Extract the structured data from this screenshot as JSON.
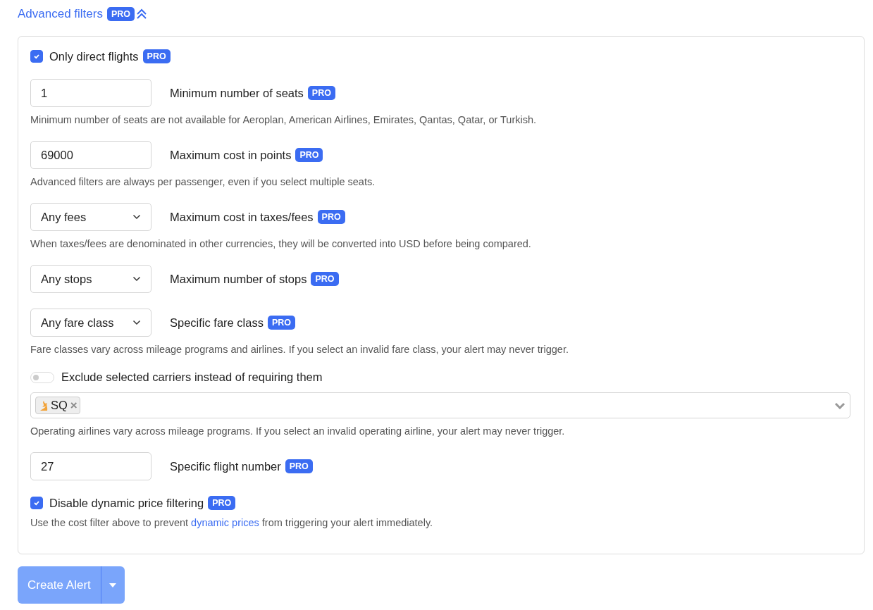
{
  "header": {
    "label": "Advanced filters",
    "badge": "PRO",
    "expanded": true
  },
  "items": [
    {
      "kind": "checkbox",
      "label": "Only direct flights",
      "badge": "PRO",
      "checked": true
    },
    {
      "kind": "input",
      "label": "Minimum number of seats",
      "badge": "PRO",
      "field": {
        "value": "1"
      },
      "note": "Minimum number of seats are not available for Aeroplan, American Airlines, Emirates, Qantas, Qatar, or Turkish."
    },
    {
      "kind": "input",
      "label": "Maximum cost in points",
      "badge": "PRO",
      "field": {
        "value": "69000"
      },
      "note": "Advanced filters are always per passenger, even if you select multiple seats."
    },
    {
      "kind": "select",
      "label": "Maximum cost in taxes/fees",
      "badge": "PRO",
      "field": {
        "value": "Any fees"
      },
      "note": "When taxes/fees are denominated in other currencies, they will be converted into USD before being compared."
    },
    {
      "kind": "select",
      "label": "Maximum number of stops",
      "badge": "PRO",
      "field": {
        "value": "Any stops"
      }
    },
    {
      "kind": "select",
      "label": "Specific fare class",
      "badge": "PRO",
      "field": {
        "value": "Any fare class"
      },
      "note": "Fare classes vary across mileage programs and airlines. If you select an invalid fare class, your alert may never trigger."
    },
    {
      "kind": "toggle",
      "label": "Exclude selected carriers instead of requiring them",
      "on": false
    },
    {
      "kind": "multiselect",
      "tags": [
        {
          "label": "SQ",
          "remove": "×"
        }
      ],
      "note": "Operating airlines vary across mileage programs. If you select an invalid operating airline, your alert may never trigger."
    },
    {
      "kind": "input",
      "label": "Specific flight number",
      "badge": "PRO",
      "field": {
        "value": "27"
      }
    },
    {
      "kind": "checkbox",
      "label": "Disable dynamic price filtering",
      "badge": "PRO",
      "checked": true,
      "note_parts": {
        "before": "Use the cost filter above to prevent ",
        "link": "dynamic prices",
        "after": " from triggering your alert immediately."
      }
    }
  ],
  "button": {
    "label": "Create Alert",
    "disabled": true
  }
}
